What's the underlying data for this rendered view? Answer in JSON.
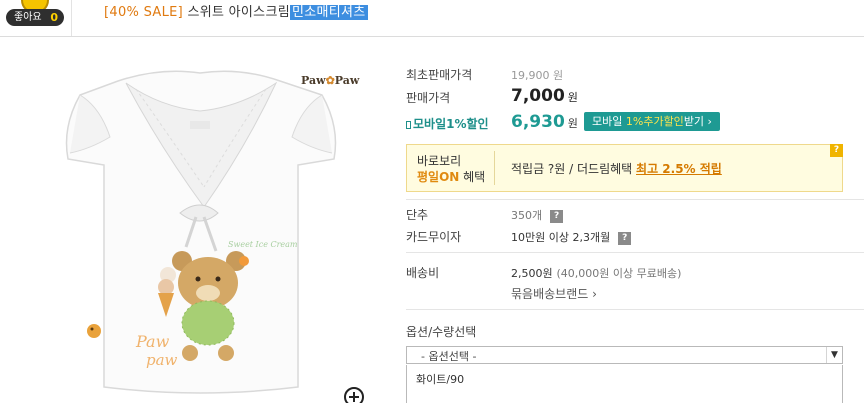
{
  "header": {
    "like_label": "좋아요",
    "like_count": "0",
    "sale_tag": "[40% SALE]",
    "product_name": "스위트 아이스크림",
    "product_highlight": "민소매티셔츠"
  },
  "image": {
    "brand_logo_left": "Paw",
    "brand_logo_right": "Paw"
  },
  "pricing": {
    "original_label": "최초판매가격",
    "original_value": "19,900 원",
    "sale_label": "판매가격",
    "sale_value": "7,000",
    "won": "원",
    "mobile_label": "모바일1%할인",
    "mobile_value": "6,930",
    "mobile_button_prefix": "모바일",
    "mobile_button_accent": "1%추가할인",
    "mobile_button_suffix": "받기 ›"
  },
  "benefit": {
    "left_line1": "바로보리",
    "left_on": "평일ON",
    "left_line2_suffix": " 혜택",
    "right_text": "적립금 ?원 / 더드림혜택 ",
    "right_max": "최고 2.5% 적립",
    "help": "?"
  },
  "details": {
    "unit_label": "단추",
    "unit_value": "350개",
    "card_label": "카드무이자",
    "card_value": "10만원 이상 2,3개월",
    "help": "?",
    "shipping_label": "배송비",
    "shipping_value": "2,500원",
    "shipping_note": "(40,000원 이상 무료배송)",
    "bundle_link": "묶음배송브랜드 ›"
  },
  "options": {
    "label": "옵션/수량선택",
    "select_placeholder": "- 옵션선택 -",
    "list_items": [
      "화이트/90"
    ]
  },
  "colors": {
    "sale_orange": "#e07a10",
    "highlight_blue": "#3d8ee0",
    "mobile_teal": "#1e9a93",
    "benefit_bg": "#fffce0"
  }
}
